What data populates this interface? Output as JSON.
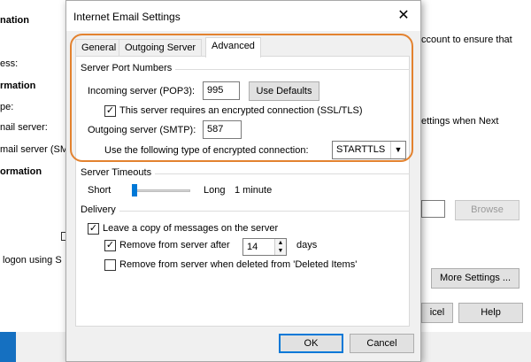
{
  "background": {
    "left_texts": [
      "nation",
      "ess:",
      "rmation",
      "pe:",
      "nail server:",
      "mail server (SM",
      "ormation"
    ],
    "right_texts": [
      "ccount to ensure that",
      "ettings when Next"
    ],
    "logon_text": "logon using S",
    "browse_label": "Browse",
    "more_settings_label": "More Settings ...",
    "cancel_partial_label": "icel",
    "help_label": "Help"
  },
  "dialog": {
    "title": "Internet Email Settings",
    "close_glyph": "✕",
    "tabs": [
      {
        "label": "General"
      },
      {
        "label": "Outgoing Server"
      },
      {
        "label": "Advanced"
      }
    ],
    "server_ports": {
      "heading": "Server Port Numbers",
      "incoming_label": "Incoming server (POP3):",
      "incoming_value": "995",
      "use_defaults_label": "Use Defaults",
      "ssl_checked": true,
      "ssl_label": "This server requires an encrypted connection (SSL/TLS)",
      "outgoing_label": "Outgoing server (SMTP):",
      "outgoing_value": "587",
      "encryption_label": "Use the following type of encrypted connection:",
      "encryption_value": "STARTTLS"
    },
    "timeouts": {
      "heading": "Server Timeouts",
      "short_label": "Short",
      "long_label": "Long",
      "value_label": "1 minute",
      "slider_level": 0.05
    },
    "delivery": {
      "heading": "Delivery",
      "leave_copy_checked": true,
      "leave_copy_label": "Leave a copy of messages on the server",
      "remove_after_checked": true,
      "remove_after_label": "Remove from server after",
      "remove_after_value": "14",
      "days_label": "days",
      "remove_deleted_checked": false,
      "remove_deleted_label": "Remove from server when deleted from 'Deleted Items'"
    },
    "ok_label": "OK",
    "cancel_label": "Cancel"
  },
  "colors": {
    "highlight": "#e3822f",
    "accent": "#0078d7",
    "taskbar_blue": "#1570c1"
  }
}
